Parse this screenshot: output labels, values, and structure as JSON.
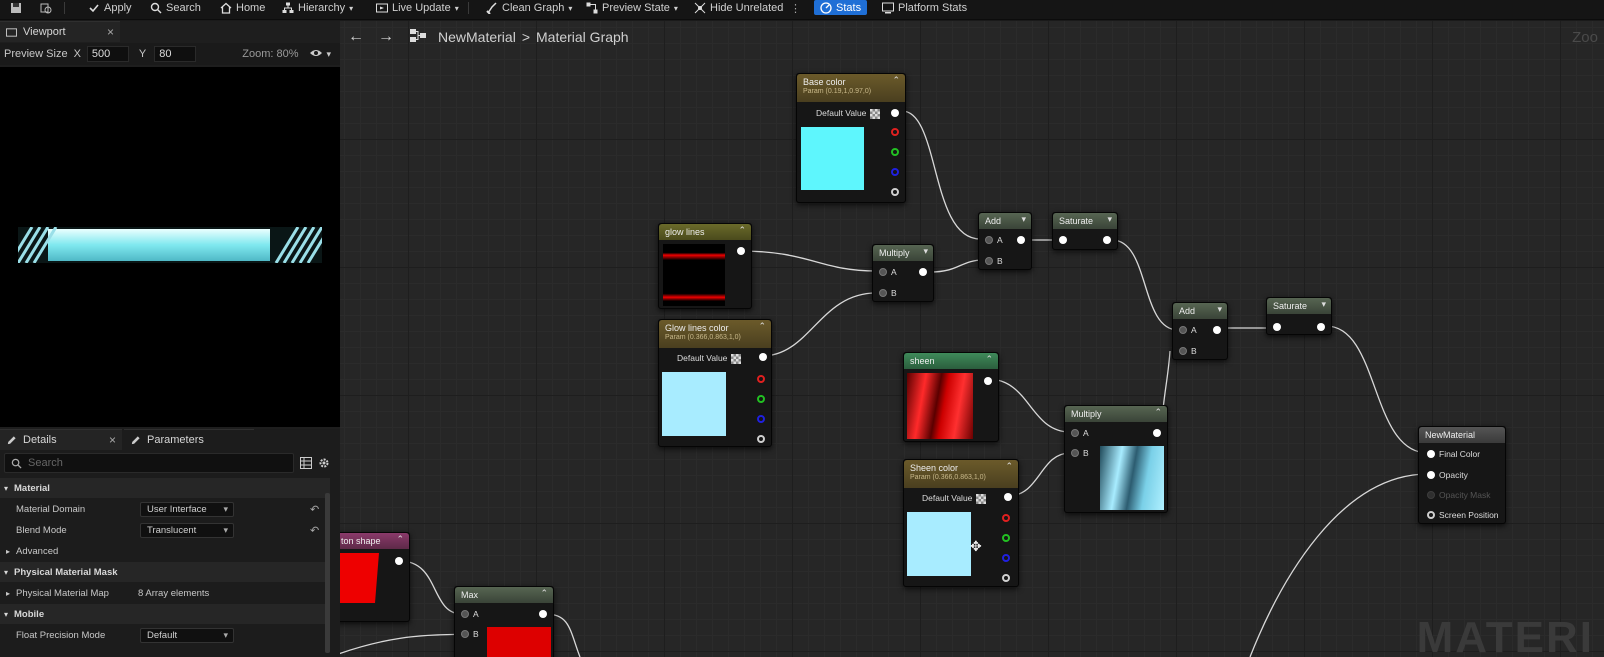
{
  "toolbar": {
    "apply": "Apply",
    "search": "Search",
    "home": "Home",
    "hierarchy": "Hierarchy",
    "live_update": "Live Update",
    "clean_graph": "Clean Graph",
    "preview_state": "Preview State",
    "hide_unrelated": "Hide Unrelated",
    "stats": "Stats",
    "platform_stats": "Platform Stats"
  },
  "viewport": {
    "tab": "Viewport",
    "preview_size_label": "Preview Size",
    "x_label": "X",
    "x_value": "500",
    "y_label": "Y",
    "y_value": "80",
    "zoom": "Zoom: 80%"
  },
  "details": {
    "tab_details": "Details",
    "tab_parameters": "Parameters",
    "search_placeholder": "Search",
    "rows": [
      {
        "label": "Material",
        "kind": "category"
      },
      {
        "label": "Material Domain",
        "value": "User Interface",
        "kind": "dropdown",
        "reset": true
      },
      {
        "label": "Blend Mode",
        "value": "Translucent",
        "kind": "dropdown",
        "reset": true
      },
      {
        "label": "Advanced",
        "kind": "sub"
      },
      {
        "label": "Physical Material Mask",
        "kind": "category"
      },
      {
        "label": "Physical Material Map",
        "value": "8 Array elements",
        "kind": "text"
      },
      {
        "label": "Mobile",
        "kind": "category"
      },
      {
        "label": "Float Precision Mode",
        "value": "Default",
        "kind": "dropdown"
      }
    ]
  },
  "graph": {
    "breadcrumb_root": "NewMaterial",
    "breadcrumb_sep": ">",
    "breadcrumb_leaf": "Material Graph",
    "zoom_corner": "Zoo",
    "watermark": "MATERI",
    "nodes": {
      "base_color": {
        "title": "Base color",
        "sub": "Param (0.19,1,0.97,0)",
        "default": "Default Value",
        "color": "#5ef6fd"
      },
      "glow_lines": {
        "title": "glow lines"
      },
      "glow_lines_color": {
        "title": "Glow lines color",
        "sub": "Param (0.366,0.863,1,0)",
        "default": "Default Value",
        "color": "#a8ecff"
      },
      "multiply1": {
        "title": "Multiply",
        "a": "A",
        "b": "B"
      },
      "add1": {
        "title": "Add",
        "a": "A",
        "b": "B"
      },
      "saturate1": {
        "title": "Saturate"
      },
      "add2": {
        "title": "Add",
        "a": "A",
        "b": "B"
      },
      "saturate2": {
        "title": "Saturate"
      },
      "sheen": {
        "title": "sheen"
      },
      "sheen_color": {
        "title": "Sheen color",
        "sub": "Param (0.366,0.863,1,0)",
        "default": "Default Value",
        "color": "#a8ecff"
      },
      "multiply2": {
        "title": "Multiply",
        "a": "A",
        "b": "B"
      },
      "new_material": {
        "title": "NewMaterial",
        "pins": [
          "Final Color",
          "Opacity",
          "Opacity Mask",
          "Screen Position"
        ]
      },
      "button_shape": {
        "title": "ton shape"
      },
      "max": {
        "title": "Max",
        "a": "A",
        "b": "B"
      }
    }
  }
}
